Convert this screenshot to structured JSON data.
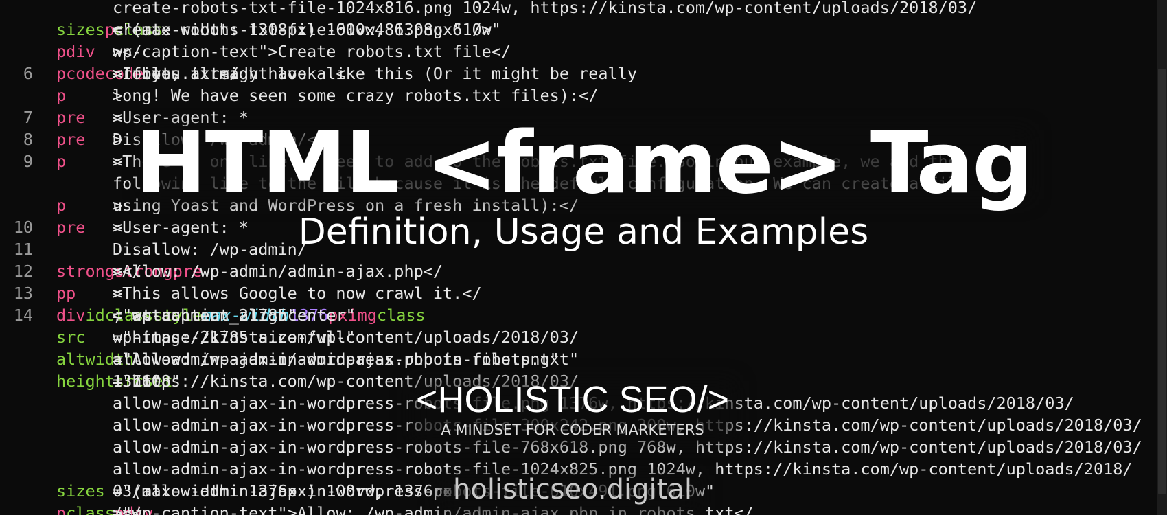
{
  "editor": {
    "lines": [
      {
        "num": "",
        "segments": [
          {
            "t": "create-robots-txt-file-1024x816.png 1024w, https://kinsta.com/wp-content/uploads/2018/03/",
            "c": "txt"
          }
        ]
      },
      {
        "num": "",
        "segments": [
          {
            "t": "create-robots-txt-file-610x486.png 610w\" ",
            "c": "txt"
          },
          {
            "t": "sizes",
            "c": "attr"
          },
          {
            "t": "=\"(max-width: 1308px) 100vw, 1308px\" />",
            "c": "txt"
          },
          {
            "t": "<",
            "c": "txt"
          },
          {
            "t": "p",
            "c": "tag"
          },
          {
            "t": " ",
            "c": "txt"
          },
          {
            "t": "class",
            "c": "attr"
          },
          {
            "t": "=\"",
            "c": "txt"
          }
        ]
      },
      {
        "num": "",
        "segments": [
          {
            "t": "wp-caption-text\">Create robots.txt file</",
            "c": "txt"
          },
          {
            "t": "p",
            "c": "tag"
          },
          {
            "t": "></",
            "c": "txt"
          },
          {
            "t": "div",
            "c": "tag"
          },
          {
            "t": ">",
            "c": "txt"
          }
        ]
      },
      {
        "num": "6",
        "segments": [
          {
            "t": "<",
            "c": "txt"
          },
          {
            "t": "p",
            "c": "tag"
          },
          {
            "t": ">If you already have a <",
            "c": "txt"
          },
          {
            "t": "code",
            "c": "tag"
          },
          {
            "t": ">robots.txt</",
            "c": "txt"
          },
          {
            "t": "code",
            "c": "tag"
          },
          {
            "t": "> file, it might look like this (Or it might be really",
            "c": "txt"
          }
        ]
      },
      {
        "num": "",
        "segments": [
          {
            "t": "long! We have seen some crazy robots.txt files):</",
            "c": "txt"
          },
          {
            "t": "p",
            "c": "tag"
          },
          {
            "t": ">",
            "c": "txt"
          }
        ]
      },
      {
        "num": "7",
        "segments": [
          {
            "t": "<",
            "c": "txt"
          },
          {
            "t": "pre",
            "c": "tag"
          },
          {
            "t": ">User-agent: *",
            "c": "txt"
          }
        ]
      },
      {
        "num": "8",
        "segments": [
          {
            "t": "Disallow: /wp-admin/</",
            "c": "txt"
          },
          {
            "t": "pre",
            "c": "tag"
          },
          {
            "t": ">",
            "c": "txt"
          }
        ]
      },
      {
        "num": "9",
        "segments": [
          {
            "t": "<",
            "c": "txt"
          },
          {
            "t": "p",
            "c": "tag"
          },
          {
            "t": ">There is one line we need to add to the robots.txt file. So in our example, we add the",
            "c": "txt"
          }
        ]
      },
      {
        "num": "",
        "segments": [
          {
            "t": "following line to the file because it is the default configuration. We can create a file",
            "c": "txt"
          }
        ]
      },
      {
        "num": "",
        "segments": [
          {
            "t": "using Yoast and WordPress on a fresh install):</",
            "c": "txt"
          },
          {
            "t": "p",
            "c": "tag"
          },
          {
            "t": ">",
            "c": "txt"
          }
        ]
      },
      {
        "num": "10",
        "segments": [
          {
            "t": "<",
            "c": "txt"
          },
          {
            "t": "pre",
            "c": "tag"
          },
          {
            "t": ">User-agent: *",
            "c": "txt"
          }
        ]
      },
      {
        "num": "11",
        "segments": [
          {
            "t": "Disallow: /wp-admin/",
            "c": "txt"
          }
        ]
      },
      {
        "num": "12",
        "segments": [
          {
            "t": "<",
            "c": "txt"
          },
          {
            "t": "strong",
            "c": "tag"
          },
          {
            "t": ">Allow: /wp-admin/admin-ajax.php</",
            "c": "txt"
          },
          {
            "t": "strong",
            "c": "tag"
          },
          {
            "t": "></",
            "c": "txt"
          },
          {
            "t": "pre",
            "c": "tag"
          },
          {
            "t": ">",
            "c": "txt"
          }
        ]
      },
      {
        "num": "13",
        "segments": [
          {
            "t": "<",
            "c": "txt"
          },
          {
            "t": "p",
            "c": "tag"
          },
          {
            "t": ">This allows Google to now crawl it.</",
            "c": "txt"
          },
          {
            "t": "p",
            "c": "tag"
          },
          {
            "t": ">",
            "c": "txt"
          }
        ]
      },
      {
        "num": "14",
        "segments": [
          {
            "t": "<",
            "c": "txt"
          },
          {
            "t": "div",
            "c": "tag"
          },
          {
            "t": " ",
            "c": "txt"
          },
          {
            "t": "id",
            "c": "attr"
          },
          {
            "t": "=\"attachment_21785\" ",
            "c": "txt"
          },
          {
            "t": "class",
            "c": "attr"
          },
          {
            "t": "=\"wp-caption aligncenter\" ",
            "c": "txt"
          },
          {
            "t": "style",
            "c": "attr"
          },
          {
            "t": "=\"",
            "c": "txt"
          },
          {
            "t": "max-width",
            "c": "css"
          },
          {
            "t": ": ",
            "c": "txt"
          },
          {
            "t": "1376",
            "c": "num"
          },
          {
            "t": "px",
            "c": "tag"
          },
          {
            "t": ";\"><",
            "c": "txt"
          },
          {
            "t": "img",
            "c": "tag"
          },
          {
            "t": " ",
            "c": "txt"
          },
          {
            "t": "class",
            "c": "attr"
          },
          {
            "t": "=\"",
            "c": "txt"
          }
        ]
      },
      {
        "num": "",
        "segments": [
          {
            "t": "wp-image-21785 size-full\" ",
            "c": "txt"
          },
          {
            "t": "src",
            "c": "attr"
          },
          {
            "t": "=\"https://kinsta.com/wp-content/uploads/2018/03/",
            "c": "txt"
          }
        ]
      },
      {
        "num": "",
        "segments": [
          {
            "t": "allow-admin-ajax-in-wordpress-robots-file.png\" ",
            "c": "txt"
          },
          {
            "t": "alt",
            "c": "attr"
          },
          {
            "t": "=\"Allow: /wp-admin/admin-ajax.php in robots.txt\" ",
            "c": "txt"
          },
          {
            "t": "width",
            "c": "attr"
          },
          {
            "t": "=\"",
            "c": "txt"
          }
        ]
      },
      {
        "num": "",
        "segments": [
          {
            "t": "1376\" ",
            "c": "txt"
          },
          {
            "t": "height",
            "c": "attr"
          },
          {
            "t": "=\"1108\" ",
            "c": "txt"
          },
          {
            "t": "srcset",
            "c": "attr"
          },
          {
            "t": "=\"https://kinsta.com/wp-content/uploads/2018/03/",
            "c": "txt"
          }
        ]
      },
      {
        "num": "",
        "segments": [
          {
            "t": "allow-admin-ajax-in-wordpress-robots-file.png 1376w, https://kinsta.com/wp-content/uploads/2018/03/",
            "c": "txt"
          }
        ]
      },
      {
        "num": "",
        "segments": [
          {
            "t": "allow-admin-ajax-in-wordpress-robots-file-300x242.png 300w, https://kinsta.com/wp-content/uploads/2018/03/",
            "c": "txt"
          }
        ]
      },
      {
        "num": "",
        "segments": [
          {
            "t": "allow-admin-ajax-in-wordpress-robots-file-768x618.png 768w, https://kinsta.com/wp-content/uploads/2018/03/",
            "c": "txt"
          }
        ]
      },
      {
        "num": "",
        "segments": [
          {
            "t": "allow-admin-ajax-in-wordpress-robots-file-1024x825.png 1024w, https://kinsta.com/wp-content/uploads/2018/",
            "c": "txt"
          }
        ]
      },
      {
        "num": "",
        "segments": [
          {
            "t": "03/allow-admin-ajax-in-wordpress-robots-file-610x491.png 610w\" ",
            "c": "txt"
          },
          {
            "t": "sizes",
            "c": "attr"
          },
          {
            "t": "=\"(max-width: 1376px) 100vw, 1376px\"",
            "c": "txt"
          }
        ]
      },
      {
        "num": "",
        "segments": [
          {
            "t": "/><",
            "c": "txt"
          },
          {
            "t": "p",
            "c": "tag"
          },
          {
            "t": " ",
            "c": "txt"
          },
          {
            "t": "class",
            "c": "attr"
          },
          {
            "t": "=\"wp-caption-text\">Allow: /wp-admin/admin-ajax.php in robots.txt</",
            "c": "txt"
          },
          {
            "t": "p",
            "c": "tag"
          },
          {
            "t": "></",
            "c": "txt"
          },
          {
            "t": "div",
            "c": "tag"
          },
          {
            "t": ">",
            "c": "txt"
          }
        ]
      }
    ]
  },
  "overlay": {
    "title": "HTML <frame> Tag",
    "subtitle": "Definition, Usage and Examples",
    "brand": "<HOLISTIC SEO/>",
    "tagline": "A MINDSET FOR CODER  MARKETERS",
    "site": "holisticseo.digital"
  },
  "colors": {
    "background": "#0b0b0b",
    "tag": "#f0518a",
    "attr": "#86d43f",
    "css_property": "#66d9ef",
    "number": "#ae81ff",
    "text": "#e6e6e6",
    "line_number": "#9a9a9a"
  }
}
